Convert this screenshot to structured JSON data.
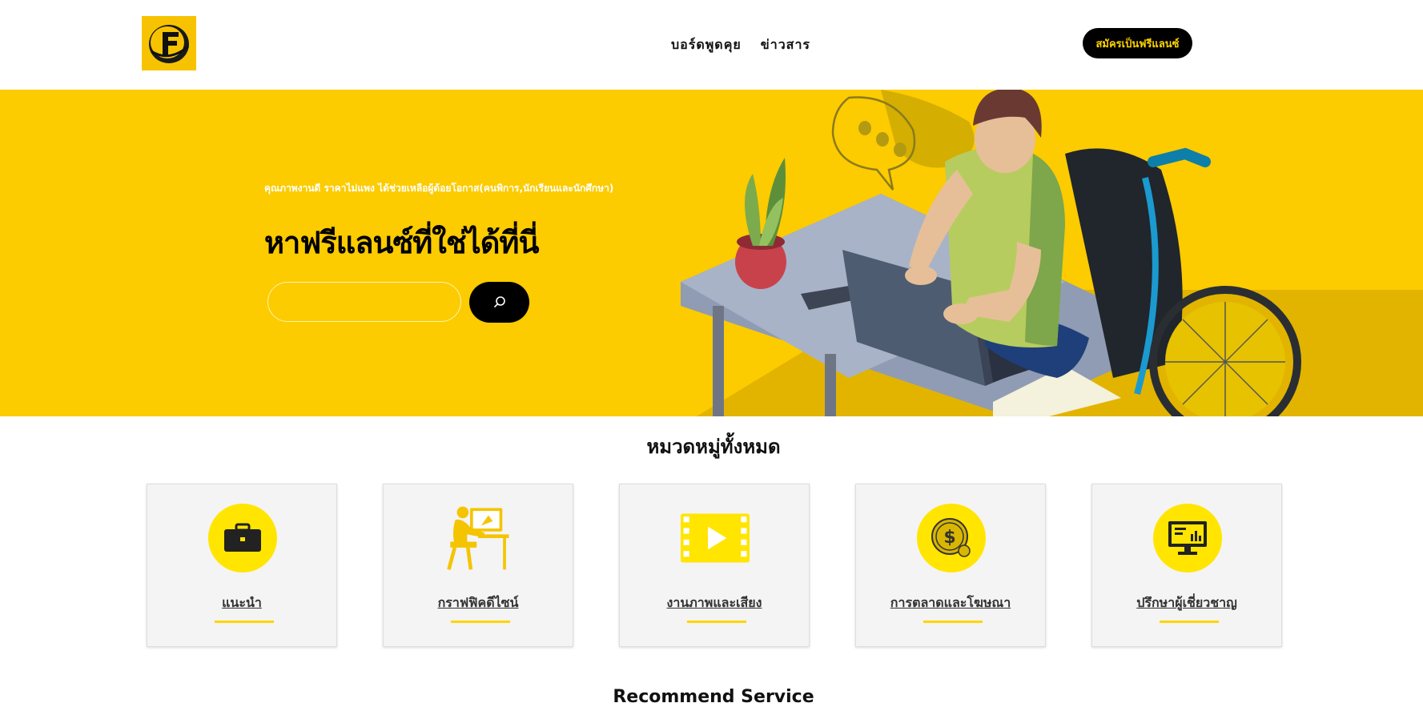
{
  "header": {
    "logo_letter": "F",
    "nav": [
      "บอร์ดพูดคุย",
      "ข่าวสาร"
    ],
    "signup_label": "สมัครเป็นฟรีแลนซ์"
  },
  "hero": {
    "tagline": "คุณภาพงานดี ราคาไม่แพง ได้ช่วยเหลือผู้ด้อยโอกาส(คนพิการ,นักเรียนและนักศึกษา)",
    "title": "หาฟรีแลนซ์ที่ใช่ได้ที่นี่",
    "search_value": ""
  },
  "categories": {
    "title": "หมวดหมู่ทั้งหมด",
    "items": [
      {
        "label": "แนะนำ",
        "icon": "briefcase-icon"
      },
      {
        "label": "กราฟฟิคดีไซน์",
        "icon": "designer-icon"
      },
      {
        "label": "งานภาพและเสียง",
        "icon": "video-icon"
      },
      {
        "label": "การตลาดและโฆษณา",
        "icon": "money-icon"
      },
      {
        "label": "ปรึกษาผู้เชี่ยวชาญ",
        "icon": "monitor-chart-icon"
      }
    ]
  },
  "recommend_title": "Recommend Service",
  "colors": {
    "brand_yellow": "#fccb00",
    "accent_yellow": "#ffe500",
    "black": "#000000"
  }
}
